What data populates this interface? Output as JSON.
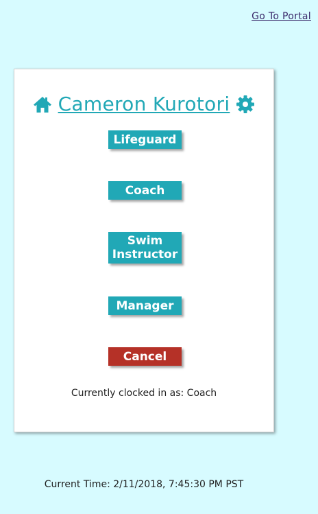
{
  "top_nav": {
    "portal_link": "Go To Portal"
  },
  "header": {
    "user_name": "Cameron Kurotori",
    "left_icon": "home-icon",
    "right_icon": "gear-icon"
  },
  "roles": [
    {
      "label": "Lifeguard"
    },
    {
      "label": "Coach"
    },
    {
      "label": "Swim Instructor"
    },
    {
      "label": "Manager"
    }
  ],
  "cancel_label": "Cancel",
  "status_text": "Currently clocked in as: Coach",
  "time_text": "Current Time: 2/11/2018, 7:45:30 PM PST",
  "colors": {
    "background": "#d7fbff",
    "accent": "#21a8b6",
    "danger": "#b53127",
    "link": "#3b2a6b"
  }
}
